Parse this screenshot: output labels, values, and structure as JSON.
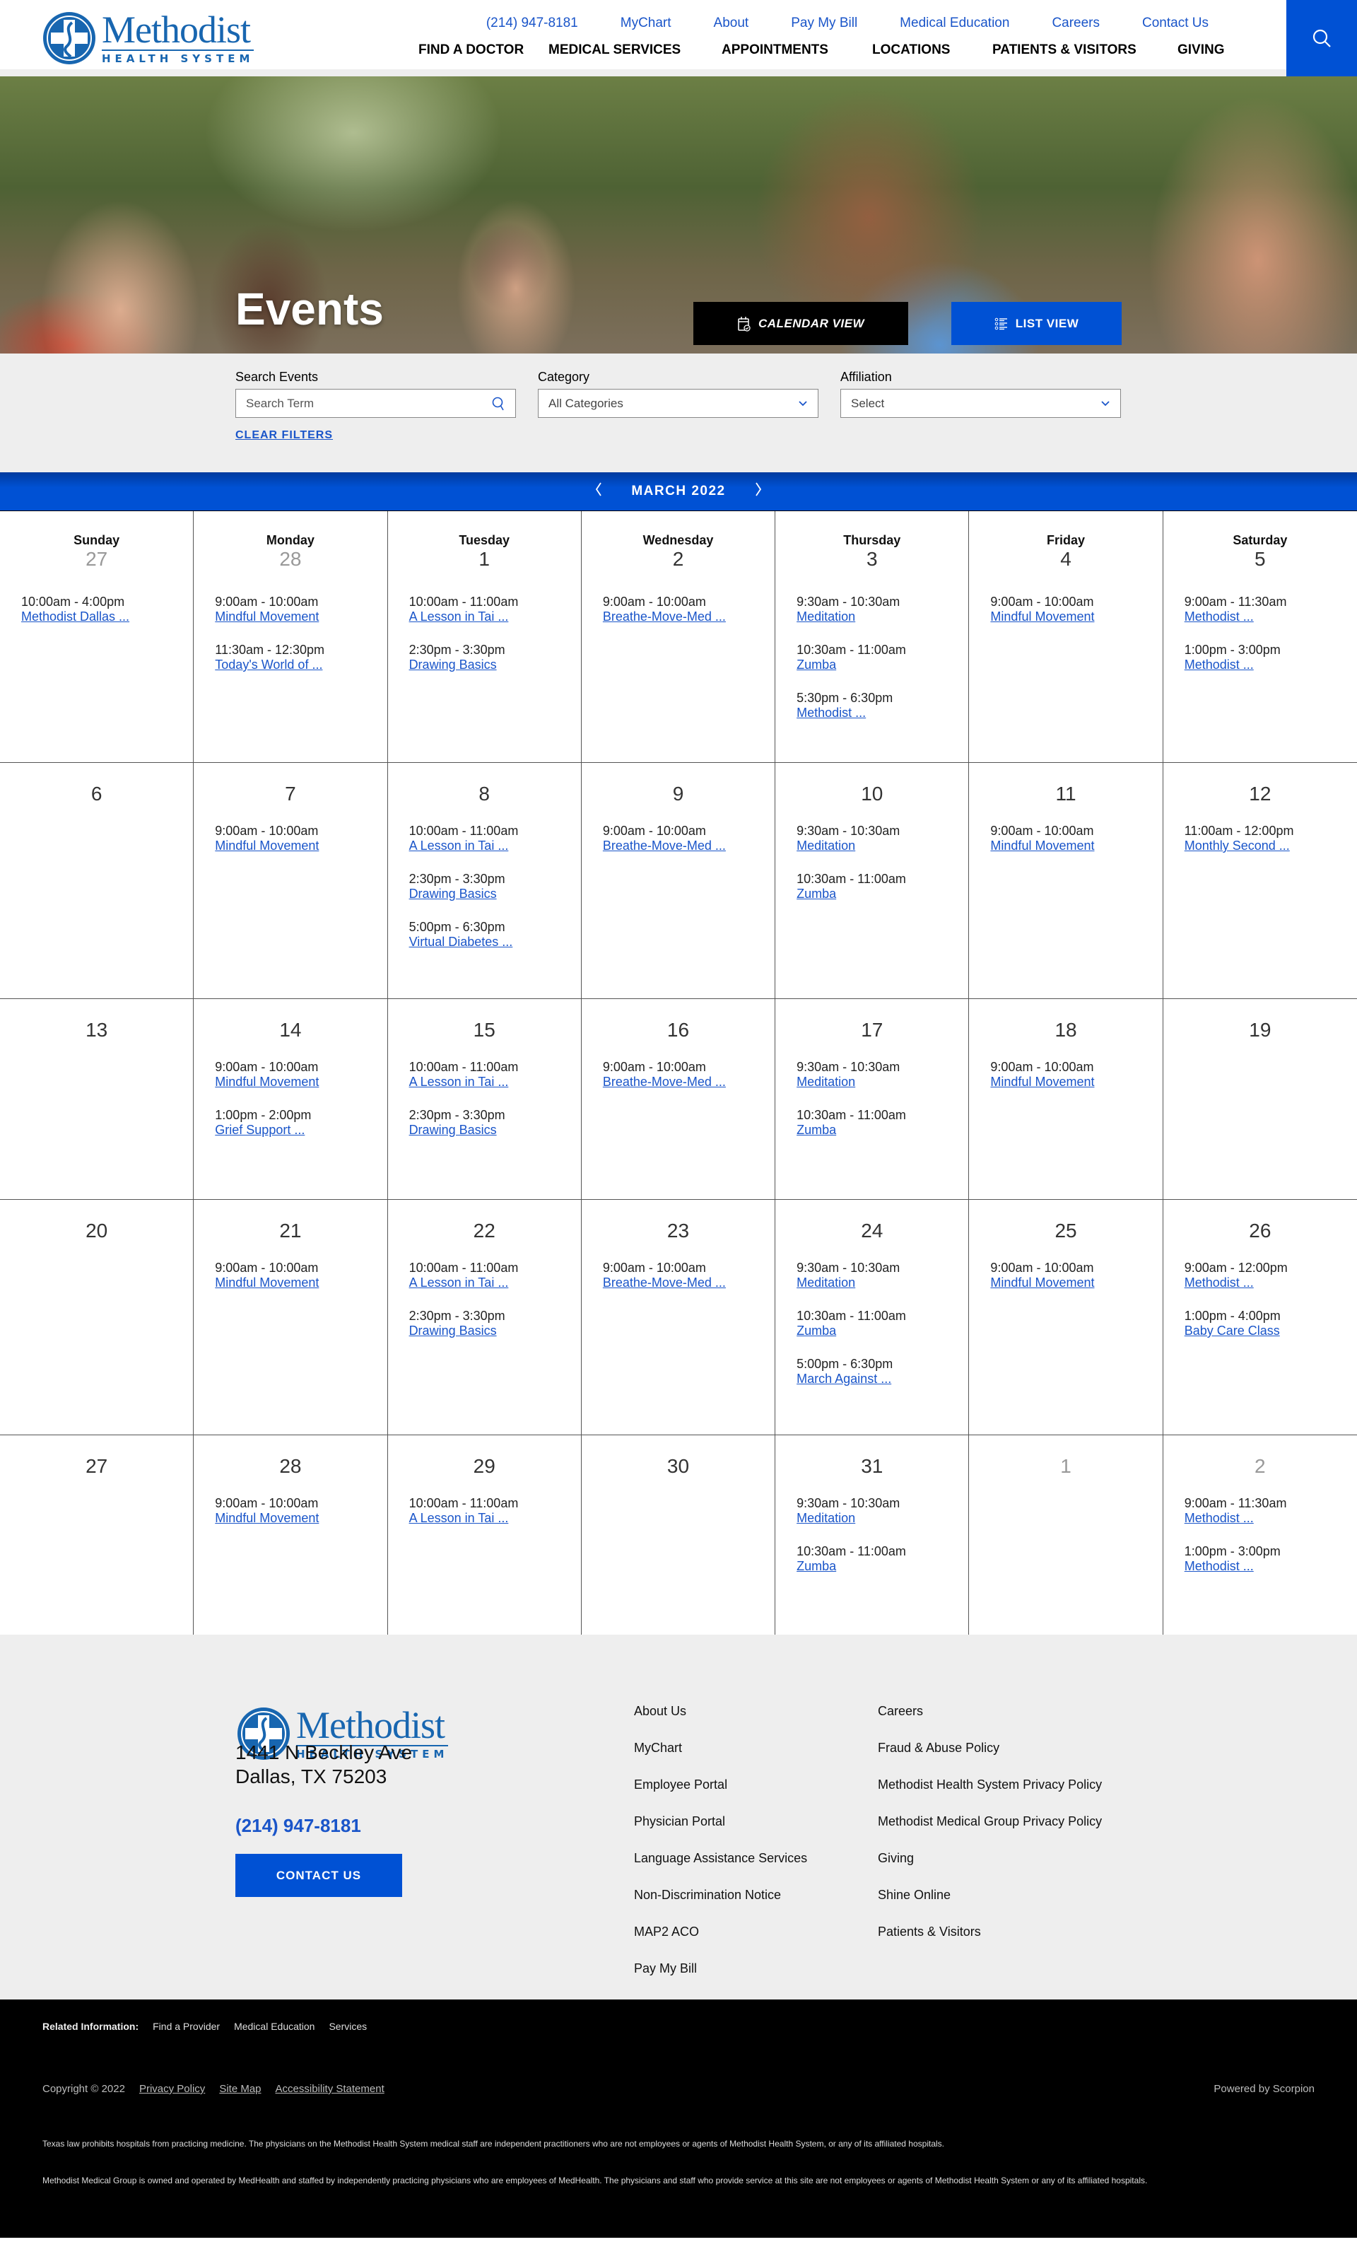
{
  "brand": {
    "name": "Methodist",
    "subtitle": "HEALTH SYSTEM",
    "color": "#1866b0",
    "accent": "#0051d4"
  },
  "utility_nav": [
    "(214) 947-8181",
    "MyChart",
    "About",
    "Pay My Bill",
    "Medical Education",
    "Careers",
    "Contact Us"
  ],
  "main_nav": [
    "FIND A DOCTOR",
    "MEDICAL SERVICES",
    "APPOINTMENTS",
    "LOCATIONS",
    "PATIENTS & VISITORS",
    "GIVING"
  ],
  "search_icon": "search-icon",
  "hero": {
    "title": "Events",
    "calendar_view_label": "CALENDAR VIEW",
    "list_view_label": "LIST VIEW"
  },
  "filters": {
    "search_label": "Search Events",
    "search_placeholder": "Search Term",
    "category_label": "Category",
    "category_value": "All Categories",
    "affiliation_label": "Affiliation",
    "affiliation_value": "Select",
    "clear_label": "CLEAR FILTERS"
  },
  "calendar": {
    "month_label": "MARCH 2022",
    "weekdays": [
      "Sunday",
      "Monday",
      "Tuesday",
      "Wednesday",
      "Thursday",
      "Friday",
      "Saturday"
    ],
    "weeks": [
      [
        {
          "day": "27",
          "other": true,
          "events": [
            {
              "time": "10:00am - 4:00pm",
              "title": "Methodist Dallas ..."
            }
          ]
        },
        {
          "day": "28",
          "other": true,
          "events": [
            {
              "time": "9:00am - 10:00am",
              "title": "Mindful Movement"
            },
            {
              "time": "11:30am - 12:30pm",
              "title": "Today's World of ..."
            }
          ]
        },
        {
          "day": "1",
          "events": [
            {
              "time": "10:00am - 11:00am",
              "title": "A Lesson in Tai ..."
            },
            {
              "time": "2:30pm - 3:30pm",
              "title": "Drawing Basics"
            }
          ]
        },
        {
          "day": "2",
          "events": [
            {
              "time": "9:00am - 10:00am",
              "title": "Breathe-Move-Med ..."
            }
          ]
        },
        {
          "day": "3",
          "events": [
            {
              "time": "9:30am - 10:30am",
              "title": "Meditation"
            },
            {
              "time": "10:30am - 11:00am",
              "title": "Zumba"
            },
            {
              "time": "5:30pm - 6:30pm",
              "title": "Methodist ..."
            }
          ]
        },
        {
          "day": "4",
          "events": [
            {
              "time": "9:00am - 10:00am",
              "title": "Mindful Movement"
            }
          ]
        },
        {
          "day": "5",
          "events": [
            {
              "time": "9:00am - 11:30am",
              "title": "Methodist ..."
            },
            {
              "time": "1:00pm - 3:00pm",
              "title": "Methodist ..."
            }
          ]
        }
      ],
      [
        {
          "day": "6",
          "events": []
        },
        {
          "day": "7",
          "events": [
            {
              "time": "9:00am - 10:00am",
              "title": "Mindful Movement"
            }
          ]
        },
        {
          "day": "8",
          "events": [
            {
              "time": "10:00am - 11:00am",
              "title": "A Lesson in Tai ..."
            },
            {
              "time": "2:30pm - 3:30pm",
              "title": "Drawing Basics"
            },
            {
              "time": "5:00pm - 6:30pm",
              "title": "Virtual Diabetes ..."
            }
          ]
        },
        {
          "day": "9",
          "events": [
            {
              "time": "9:00am - 10:00am",
              "title": "Breathe-Move-Med ..."
            }
          ]
        },
        {
          "day": "10",
          "events": [
            {
              "time": "9:30am - 10:30am",
              "title": "Meditation"
            },
            {
              "time": "10:30am - 11:00am",
              "title": "Zumba"
            }
          ]
        },
        {
          "day": "11",
          "events": [
            {
              "time": "9:00am - 10:00am",
              "title": "Mindful Movement"
            }
          ]
        },
        {
          "day": "12",
          "events": [
            {
              "time": "11:00am - 12:00pm",
              "title": "Monthly Second ..."
            }
          ]
        }
      ],
      [
        {
          "day": "13",
          "events": []
        },
        {
          "day": "14",
          "events": [
            {
              "time": "9:00am - 10:00am",
              "title": "Mindful Movement"
            },
            {
              "time": "1:00pm - 2:00pm",
              "title": "Grief Support ..."
            }
          ]
        },
        {
          "day": "15",
          "events": [
            {
              "time": "10:00am - 11:00am",
              "title": "A Lesson in Tai ..."
            },
            {
              "time": "2:30pm - 3:30pm",
              "title": "Drawing Basics"
            }
          ]
        },
        {
          "day": "16",
          "events": [
            {
              "time": "9:00am - 10:00am",
              "title": "Breathe-Move-Med ..."
            }
          ]
        },
        {
          "day": "17",
          "events": [
            {
              "time": "9:30am - 10:30am",
              "title": "Meditation"
            },
            {
              "time": "10:30am - 11:00am",
              "title": "Zumba"
            }
          ]
        },
        {
          "day": "18",
          "events": [
            {
              "time": "9:00am - 10:00am",
              "title": "Mindful Movement"
            }
          ]
        },
        {
          "day": "19",
          "events": []
        }
      ],
      [
        {
          "day": "20",
          "events": []
        },
        {
          "day": "21",
          "events": [
            {
              "time": "9:00am - 10:00am",
              "title": "Mindful Movement"
            }
          ]
        },
        {
          "day": "22",
          "events": [
            {
              "time": "10:00am - 11:00am",
              "title": "A Lesson in Tai ..."
            },
            {
              "time": "2:30pm - 3:30pm",
              "title": "Drawing Basics"
            }
          ]
        },
        {
          "day": "23",
          "events": [
            {
              "time": "9:00am - 10:00am",
              "title": "Breathe-Move-Med ..."
            }
          ]
        },
        {
          "day": "24",
          "events": [
            {
              "time": "9:30am - 10:30am",
              "title": "Meditation"
            },
            {
              "time": "10:30am - 11:00am",
              "title": "Zumba"
            },
            {
              "time": "5:00pm - 6:30pm",
              "title": "March Against ..."
            }
          ]
        },
        {
          "day": "25",
          "events": [
            {
              "time": "9:00am - 10:00am",
              "title": "Mindful Movement"
            }
          ]
        },
        {
          "day": "26",
          "events": [
            {
              "time": "9:00am - 12:00pm",
              "title": "Methodist ..."
            },
            {
              "time": "1:00pm - 4:00pm",
              "title": "Baby Care Class"
            }
          ]
        }
      ],
      [
        {
          "day": "27",
          "events": []
        },
        {
          "day": "28",
          "events": [
            {
              "time": "9:00am - 10:00am",
              "title": "Mindful Movement"
            }
          ]
        },
        {
          "day": "29",
          "events": [
            {
              "time": "10:00am - 11:00am",
              "title": "A Lesson in Tai ..."
            }
          ]
        },
        {
          "day": "30",
          "events": []
        },
        {
          "day": "31",
          "events": [
            {
              "time": "9:30am - 10:30am",
              "title": "Meditation"
            },
            {
              "time": "10:30am - 11:00am",
              "title": "Zumba"
            }
          ]
        },
        {
          "day": "1",
          "other": true,
          "events": []
        },
        {
          "day": "2",
          "other": true,
          "events": [
            {
              "time": "9:00am - 11:30am",
              "title": "Methodist ..."
            },
            {
              "time": "1:00pm - 3:00pm",
              "title": "Methodist ..."
            }
          ]
        }
      ]
    ]
  },
  "footer": {
    "address_line1": "1441 N Beckley Ave",
    "address_line2": "Dallas, TX 75203",
    "phone": "(214) 947-8181",
    "contact_label": "CONTACT US",
    "links_col1": [
      "About Us",
      "MyChart",
      "Employee Portal",
      "Physician Portal",
      "Language Assistance Services",
      "Non-Discrimination Notice",
      "MAP2 ACO",
      "Pay My Bill"
    ],
    "links_col2": [
      "Careers",
      "Fraud & Abuse Policy",
      "Methodist Health System Privacy Policy",
      "Methodist Medical Group Privacy Policy",
      "Giving",
      "Shine Online",
      "Patients & Visitors"
    ]
  },
  "legal": {
    "related_label": "Related Information:",
    "related_links": [
      "Find a Provider",
      "Medical Education",
      "Services"
    ],
    "copyright": "Copyright © 2022",
    "legal_links": [
      "Privacy Policy",
      "Site Map",
      "Accessibility Statement"
    ],
    "powered_by": "Powered by Scorpion",
    "disclaimer1": "Texas law prohibits hospitals from practicing medicine. The physicians on the Methodist Health System medical staff are independent practitioners who are not employees or agents of Methodist Health System, or any of its affiliated hospitals.",
    "disclaimer2": "Methodist Medical Group is owned and operated by MedHealth and staffed by independently practicing physicians who are employees of MedHealth. The physicians and staff who provide service at this site are not employees or agents of Methodist Health System or any of its affiliated hospitals."
  }
}
